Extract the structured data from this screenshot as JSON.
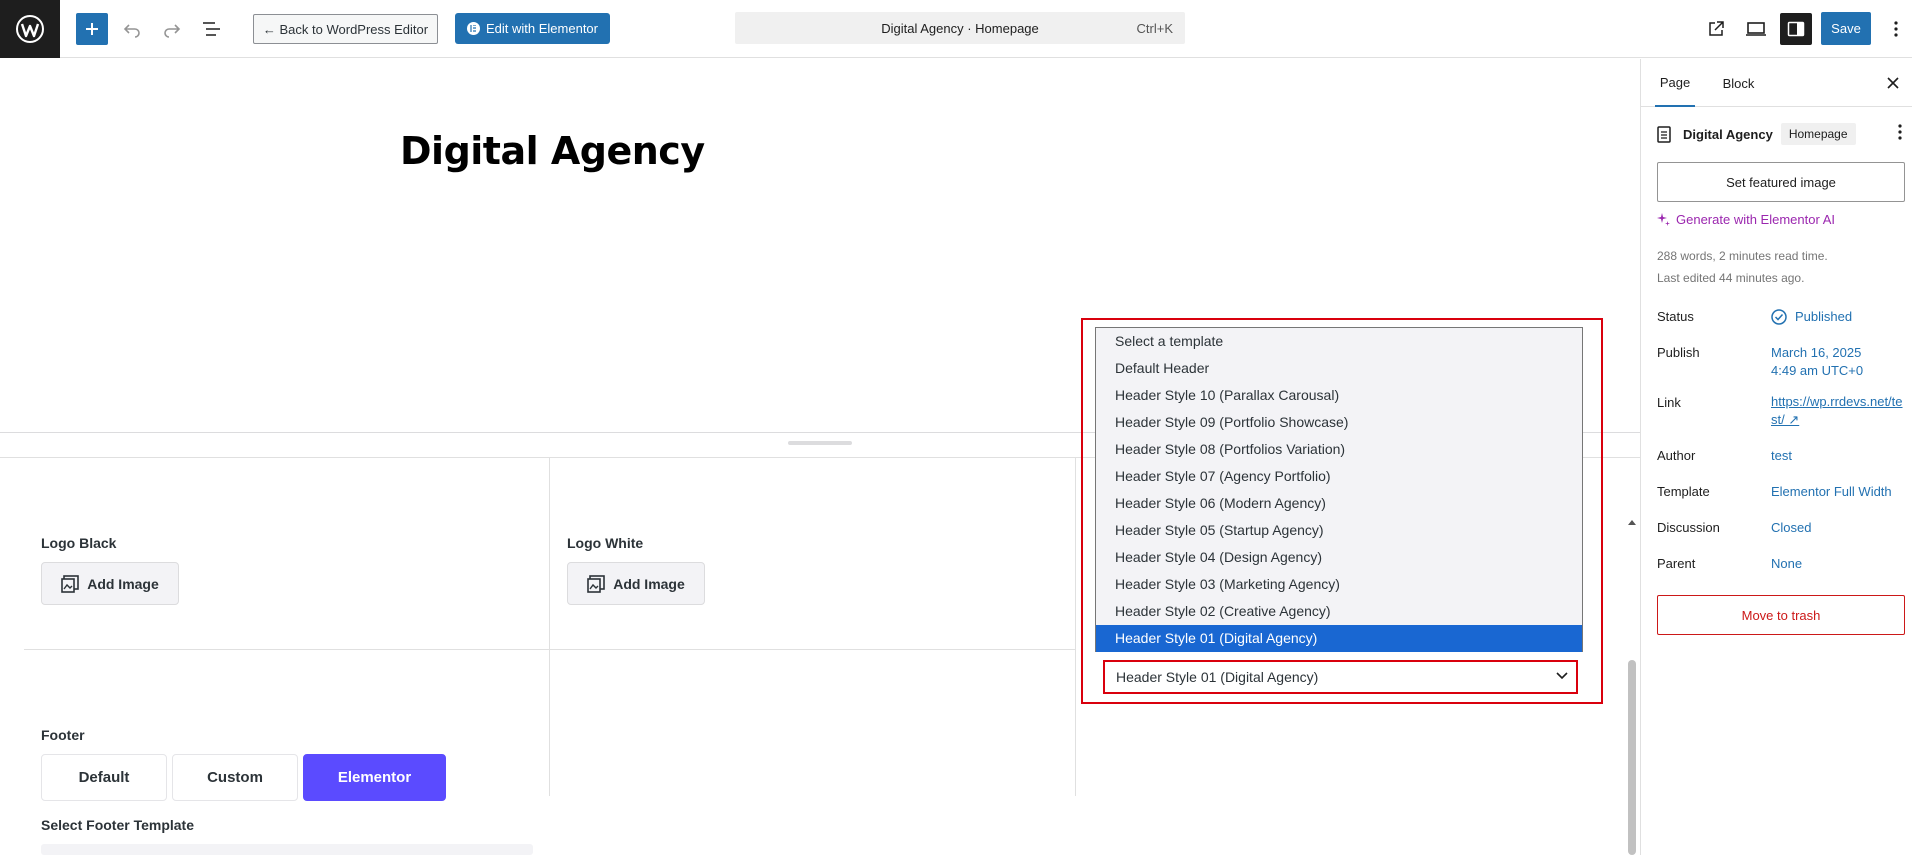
{
  "toolbar": {
    "back_label": "← Back to WordPress Editor",
    "elementor_label": "Edit with Elementor",
    "command_title": "Digital Agency · Homepage",
    "command_shortcut": "Ctrl+K",
    "save_label": "Save"
  },
  "canvas": {
    "page_title": "Digital Agency"
  },
  "meta": {
    "logo_black_label": "Logo Black",
    "logo_white_label": "Logo White",
    "add_image_label": "Add Image",
    "footer_label": "Footer",
    "footer_options": [
      "Default",
      "Custom",
      "Elementor"
    ],
    "footer_active": "Elementor",
    "select_footer_label": "Select Footer Template"
  },
  "header_select": {
    "options": [
      "Select a template",
      "Default Header",
      "Header Style 10 (Parallax Carousal)",
      "Header Style 09 (Portfolio Showcase)",
      "Header Style 08 (Portfolios Variation)",
      "Header Style 07 (Agency Portfolio)",
      "Header Style 06 (Modern Agency)",
      "Header Style 05 (Startup Agency)",
      "Header Style 04 (Design Agency)",
      "Header Style 03 (Marketing Agency)",
      "Header Style 02 (Creative Agency)",
      "Header Style 01 (Digital Agency)"
    ],
    "selected": "Header Style 01 (Digital Agency)",
    "highlight_color": "#d9000d"
  },
  "sidebar": {
    "tabs": [
      "Page",
      "Block"
    ],
    "doc_title": "Digital Agency",
    "doc_badge": "Homepage",
    "featured_image_label": "Set featured image",
    "ai_label": "Generate with Elementor AI",
    "stats_line1": "288 words, 2 minutes read time.",
    "stats_line2": "Last edited 44 minutes ago.",
    "props": {
      "status_label": "Status",
      "status_value": "Published",
      "publish_label": "Publish",
      "publish_date": "March 16, 2025",
      "publish_time": "4:49 am UTC+0",
      "link_label": "Link",
      "link_value": "https://wp.rrdevs.net/test/ ↗",
      "author_label": "Author",
      "author_value": "test",
      "template_label": "Template",
      "template_value": "Elementor Full Width",
      "discussion_label": "Discussion",
      "discussion_value": "Closed",
      "parent_label": "Parent",
      "parent_value": "None"
    },
    "trash_label": "Move to trash"
  },
  "colors": {
    "accent": "#2271b1",
    "elementor_purple": "#5b4bff",
    "selected_option": "#1967d2",
    "danger": "#cc1818"
  }
}
